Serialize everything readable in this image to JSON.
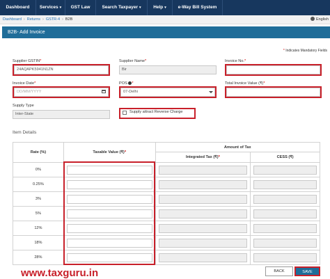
{
  "nav": {
    "items": [
      {
        "label": "Dashboard",
        "has_caret": false
      },
      {
        "label": "Services",
        "has_caret": true
      },
      {
        "label": "GST Law",
        "has_caret": false
      },
      {
        "label": "Search Taxpayer",
        "has_caret": true
      },
      {
        "label": "Help",
        "has_caret": true
      },
      {
        "label": "e-Way Bill System",
        "has_caret": false
      }
    ],
    "caret": "▾"
  },
  "breadcrumb": {
    "items": [
      "Dashboard",
      "Returns",
      "GSTR-4",
      "B2B"
    ],
    "separator": "›"
  },
  "language": "English",
  "panel": {
    "title": "B2B- Add Invoice",
    "mandatory_note": "Indicates Mandatory Fields"
  },
  "form": {
    "supplier_gstin": {
      "label": "Supplier GSTIN",
      "value": "24AQAPK5941N1ZN"
    },
    "supplier_name": {
      "label": "Supplier Name",
      "value": "Bir"
    },
    "invoice_no": {
      "label": "Invoice No.",
      "value": ""
    },
    "invoice_date": {
      "label": "Invoice Date",
      "placeholder": "DD/MM/YYYY"
    },
    "pos": {
      "label": "POS",
      "value": "07-Delhi",
      "info_icon": "info-icon"
    },
    "total_invoice_value": {
      "label": "Total Invoice Value (₹)",
      "value": ""
    },
    "supply_type": {
      "label": "Supply Type",
      "value": "Inter-State"
    },
    "reverse_charge": {
      "label": "Supply attract Reverse Charge",
      "checked": false
    }
  },
  "item_details": {
    "title": "Item Details",
    "headers": {
      "rate": "Rate (%)",
      "taxable_value": "Taxable Value (₹)",
      "amount_of_tax": "Amount of Tax",
      "integrated_tax": "Integrated Tax (₹)",
      "cess": "CESS (₹)"
    },
    "rates": [
      "0%",
      "0.25%",
      "3%",
      "5%",
      "12%",
      "18%",
      "28%"
    ]
  },
  "buttons": {
    "back": "BACK",
    "save": "SAVE"
  },
  "watermark": "www.taxguru.in",
  "colors": {
    "nav_bg": "#17375e",
    "panel_header": "#1f6d99",
    "highlight_border": "#c8202a",
    "mandatory_star": "#cc0000",
    "link": "#1f6fb5"
  }
}
